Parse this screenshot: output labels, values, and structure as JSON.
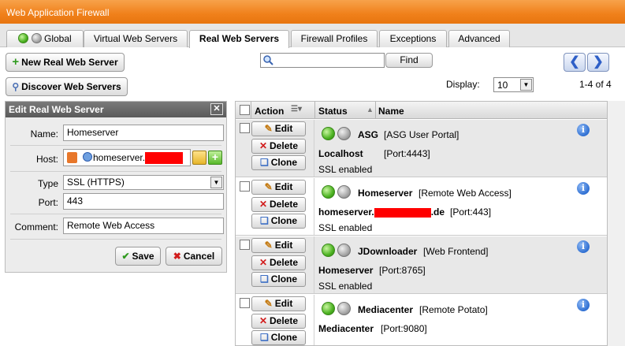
{
  "window": {
    "title": "Web Application Firewall"
  },
  "tabs": [
    {
      "label": "Global"
    },
    {
      "label": "Virtual Web Servers"
    },
    {
      "label": "Real Web Servers"
    },
    {
      "label": "Firewall Profiles"
    },
    {
      "label": "Exceptions"
    },
    {
      "label": "Advanced"
    }
  ],
  "toolbar": {
    "new_label": "New Real Web Server",
    "discover_label": "Discover Web Servers",
    "search_value": "",
    "find_label": "Find",
    "display_label": "Display:",
    "display_value": "10",
    "pagination": "1-4 of 4"
  },
  "edit_panel": {
    "title": "Edit Real Web Server",
    "name_label": "Name:",
    "name_value": "Homeserver",
    "host_label": "Host:",
    "host_value": "homeserver.",
    "type_label": "Type",
    "type_value": "SSL (HTTPS)",
    "port_label": "Port:",
    "port_value": "443",
    "comment_label": "Comment:",
    "comment_value": "Remote Web Access",
    "save_label": "Save",
    "cancel_label": "Cancel"
  },
  "table": {
    "headers": {
      "action": "Action",
      "status": "Status",
      "name": "Name"
    },
    "action_labels": {
      "edit": "Edit",
      "delete": "Delete",
      "clone": "Clone"
    },
    "rows": [
      {
        "name": "ASG",
        "comment": "[ASG User Portal]",
        "host": "Localhost",
        "port": "[Port:4443]",
        "ssl": "SSL enabled"
      },
      {
        "name": "Homeserver",
        "comment": "[Remote Web Access]",
        "host": "homeserver.",
        "host_suffix": ".de",
        "port": "[Port:443]",
        "ssl": "SSL enabled"
      },
      {
        "name": "JDownloader",
        "comment": "[Web Frontend]",
        "host": "Homeserver",
        "port": "[Port:8765]",
        "ssl": "SSL enabled"
      },
      {
        "name": "Mediacenter",
        "comment": "[Remote Potato]",
        "host": "Mediacenter",
        "port": "[Port:9080]",
        "ssl": ""
      }
    ]
  },
  "colors": {
    "titlebar": "#f0801a",
    "accent_green": "#4db322",
    "redaction": "#ff0000"
  }
}
